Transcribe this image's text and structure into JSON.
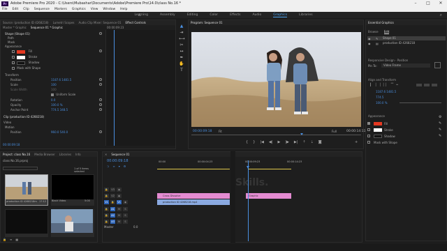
{
  "titlebar": {
    "app_icon": "Pr",
    "title": "Adobe Premiere Pro 2020 - C:\\Users\\Mubashar\\Documents\\Adobe\\Premiere Pro\\14.0\\class No.16 *"
  },
  "menubar": {
    "items": [
      "File",
      "Edit",
      "Clip",
      "Sequence",
      "Markers",
      "Graphics",
      "View",
      "Window",
      "Help"
    ]
  },
  "workspaces": {
    "items": [
      "Learning",
      "Assembly",
      "Editing",
      "Color",
      "Effects",
      "Audio",
      "Graphics",
      "Libraries"
    ],
    "active_index": 6
  },
  "effect_controls": {
    "tabs": [
      "Source: (production ID 4268218)",
      "Lumetri Scopes",
      "Audio Clip Mixer: Sequence 01",
      "Effect Controls"
    ],
    "subtabs": [
      "Master * Graphic",
      "Sequence 01 * Graphic"
    ],
    "timecode": "00:00:09:23",
    "rows": [
      {
        "label": "Shape (Shape 01)"
      },
      {
        "label": "Path"
      },
      {
        "label": "Mask"
      },
      {
        "label": "Appearance"
      },
      {
        "label": "Fill"
      },
      {
        "label": "Stroke"
      },
      {
        "label": "Shadow"
      },
      {
        "label": "Mask with Shape"
      },
      {
        "label": "Transform"
      },
      {
        "label": "Position",
        "value": "1187.6   1481.5"
      },
      {
        "label": "Scale",
        "value": "100"
      },
      {
        "label": "Scale Width",
        "value": "100"
      },
      {
        "label": "Uniform Scale"
      },
      {
        "label": "Rotation",
        "value": "0.0"
      },
      {
        "label": "Opacity",
        "value": "100.0 %"
      },
      {
        "label": "Anchor Point",
        "value": "774.5   348.5"
      },
      {
        "label": "Clip (production ID 4268218)"
      },
      {
        "label": "Video"
      },
      {
        "label": "Motion"
      },
      {
        "label": "Position",
        "value": "960.0   540.0"
      }
    ],
    "footer_time": "00:00:09:18",
    "fill_color": "#e53821",
    "stroke_color": "#ffffff"
  },
  "program": {
    "title": "Program: Sequence 01",
    "timecode": "00:00:09:18",
    "fit": "Fit",
    "quality": "Full",
    "duration": "00:00:14:11"
  },
  "project": {
    "tabs": [
      "Project: class No.16",
      "Media Browser",
      "Libraries",
      "Info"
    ],
    "file": "class No.16.prproj",
    "items_selected": "1 of 5 items selected",
    "clips": [
      {
        "name": "production ID 4268218mp4",
        "duration": "17:12"
      },
      {
        "name": "Black Video",
        "duration": "5:00"
      },
      {
        "name": "",
        "duration": ""
      },
      {
        "name": "",
        "duration": ""
      }
    ]
  },
  "sequence": {
    "tab": "Sequence 01",
    "timecode": "00:00:09:18",
    "ruler": [
      "00:00",
      "00:00:04:23",
      "00:00:09:23",
      "00:00:14:23"
    ],
    "tracks": [
      "V3",
      "V2",
      "V1",
      "A1",
      "A2",
      "A3"
    ],
    "master": "Master",
    "master_value": "0.0",
    "clips": [
      {
        "name": "Cross Dissolve",
        "track": "V2",
        "color": "#e48bd1"
      },
      {
        "name": "Graphic",
        "track": "V2b",
        "color": "#e48bd1"
      },
      {
        "name": "production ID 4268218.mp4",
        "track": "V1",
        "color": "#8aa9e0"
      }
    ],
    "watermark": "Skills."
  },
  "essential_graphics": {
    "title": "Essential Graphics",
    "tabs": [
      "Browse",
      "Edit"
    ],
    "layers": [
      "Shape 01",
      "production ID 4268218"
    ],
    "responsive_design": "Responsive Design - Position",
    "pin_to": "Pin To:",
    "pin_value": "Video Frame",
    "align_transform": "Align and Transform",
    "position": "1187.6   1481.5",
    "size": "774.5",
    "opacity": "100.0 %",
    "appearance": "Appearance",
    "fill": "Fill",
    "stroke": "Stroke",
    "shadow": "Shadow",
    "mask": "Mask with Shape"
  },
  "colors": {
    "accent": "#4aa3f0",
    "fill": "#e53821",
    "clip_pink": "#e48bd1",
    "clip_blue": "#8aa9e0"
  }
}
